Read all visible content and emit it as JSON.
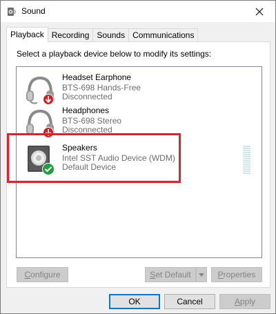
{
  "window": {
    "title": "Sound",
    "close_icon": "close-icon"
  },
  "tabs": [
    {
      "label": "Playback",
      "active": true
    },
    {
      "label": "Recording",
      "active": false
    },
    {
      "label": "Sounds",
      "active": false
    },
    {
      "label": "Communications",
      "active": false
    }
  ],
  "panel": {
    "instruction": "Select a playback device below to modify its settings:"
  },
  "devices": [
    {
      "name": "Headset Earphone",
      "description": "BTS-698 Hands-Free",
      "state": "Disconnected",
      "icon": "headset-icon",
      "badge": "disconnected-arrow-badge",
      "badge_color": "#d91c1c"
    },
    {
      "name": "Headphones",
      "description": "BTS-698 Stereo",
      "state": "Disconnected",
      "icon": "headphones-icon",
      "badge": "disconnected-arrow-badge",
      "badge_color": "#d91c1c"
    },
    {
      "name": "Speakers",
      "description": "Intel SST Audio Device (WDM)",
      "state": "Default Device",
      "icon": "speaker-icon",
      "badge": "default-check-badge",
      "badge_color": "#1e9e3c"
    }
  ],
  "buttons": {
    "configure": {
      "prefix": "",
      "underlined": "C",
      "rest": "onfigure"
    },
    "set_default": {
      "prefix": "",
      "underlined": "S",
      "rest": "et Default"
    },
    "properties": {
      "prefix": "",
      "underlined": "P",
      "rest": "roperties"
    },
    "ok": "OK",
    "cancel": "Cancel",
    "apply": {
      "prefix": "",
      "underlined": "A",
      "rest": "pply"
    }
  },
  "colors": {
    "highlight_box": "#e3202a",
    "accent": "#0078d7"
  }
}
